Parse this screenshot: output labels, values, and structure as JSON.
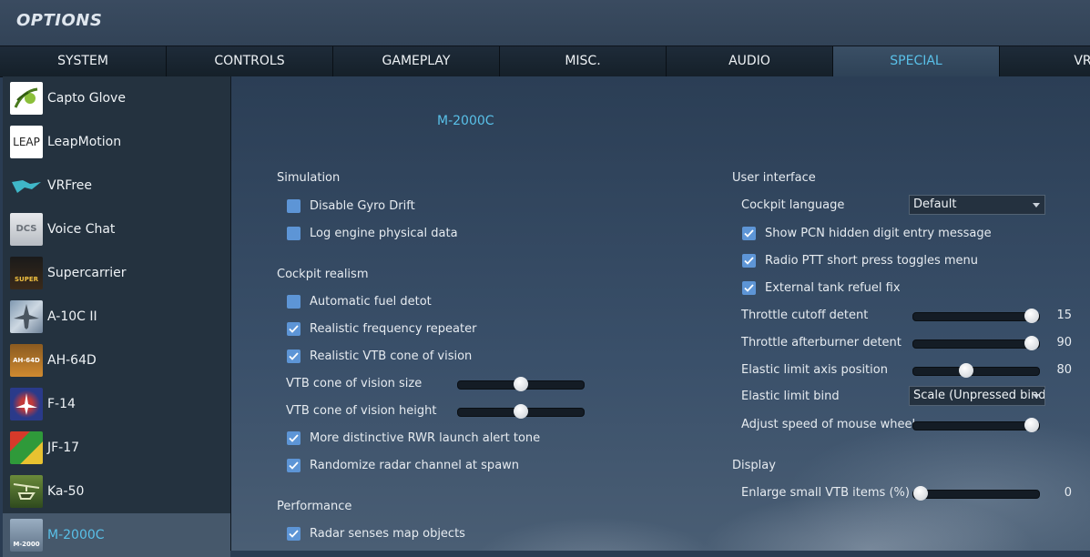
{
  "window": {
    "title": "OPTIONS"
  },
  "tabs": [
    "SYSTEM",
    "CONTROLS",
    "GAMEPLAY",
    "MISC.",
    "AUDIO",
    "SPECIAL",
    "VR"
  ],
  "active_tab": "SPECIAL",
  "sidebar": {
    "items": [
      {
        "label": "Capto Glove",
        "icon": "capto-glove-icon"
      },
      {
        "label": "LeapMotion",
        "icon": "leapmotion-icon",
        "icon_text": "LEAP"
      },
      {
        "label": "VRFree",
        "icon": "vrfree-icon"
      },
      {
        "label": "Voice Chat",
        "icon": "voice-chat-icon",
        "icon_text": "DCS"
      },
      {
        "label": "Supercarrier",
        "icon": "supercarrier-icon",
        "icon_text": "SUPER"
      },
      {
        "label": "A-10C II",
        "icon": "a10c-icon"
      },
      {
        "label": "AH-64D",
        "icon": "ah64d-icon",
        "icon_text": "AH-64D"
      },
      {
        "label": "F-14",
        "icon": "f14-icon"
      },
      {
        "label": "JF-17",
        "icon": "jf17-icon"
      },
      {
        "label": "Ka-50",
        "icon": "ka50-icon"
      },
      {
        "label": "M-2000C",
        "icon": "m2000c-icon",
        "icon_text": "M-2000"
      }
    ],
    "active": "M-2000C"
  },
  "main": {
    "module_title": "M-2000C",
    "left": {
      "simulation": {
        "title": "Simulation",
        "disable_gyro_drift": {
          "label": "Disable Gyro Drift",
          "checked": false
        },
        "log_engine": {
          "label": "Log engine physical data",
          "checked": false
        }
      },
      "cockpit_realism": {
        "title": "Cockpit realism",
        "auto_fuel_detot": {
          "label": "Automatic fuel detot",
          "checked": false
        },
        "freq_repeater": {
          "label": "Realistic frequency repeater",
          "checked": true
        },
        "vtb_cone": {
          "label": "Realistic VTB cone of vision",
          "checked": true
        },
        "vtb_cone_size": {
          "label": "VTB cone of vision size",
          "value_fraction": 0.5
        },
        "vtb_cone_height": {
          "label": "VTB cone of vision height",
          "value_fraction": 0.5
        },
        "rwr_tone": {
          "label": "More distinctive RWR launch alert tone",
          "checked": true
        },
        "radar_channel": {
          "label": "Randomize radar channel at spawn",
          "checked": true
        }
      },
      "performance": {
        "title": "Performance",
        "radar_map": {
          "label": "Radar senses map objects",
          "checked": true
        }
      }
    },
    "right": {
      "user_interface": {
        "title": "User interface",
        "cockpit_language": {
          "label": "Cockpit language",
          "value": "Default"
        },
        "pcn_message": {
          "label": "Show PCN hidden digit entry message",
          "checked": true
        },
        "radio_ptt": {
          "label": "Radio PTT short press toggles menu",
          "checked": true
        },
        "tank_refuel": {
          "label": "External tank refuel fix",
          "checked": true
        },
        "throttle_cutoff": {
          "label": "Throttle cutoff detent",
          "value": "15",
          "value_fraction": 1.0
        },
        "throttle_ab": {
          "label": "Throttle afterburner detent",
          "value": "90",
          "value_fraction": 1.0
        },
        "elastic_axis": {
          "label": "Elastic limit axis position",
          "value": "80",
          "value_fraction": 0.41
        },
        "elastic_bind": {
          "label": "Elastic limit bind",
          "value": "Scale (Unpressed bind"
        },
        "mouse_wheel": {
          "label": "Adjust speed of mouse wheel",
          "value_fraction": 1.0
        }
      },
      "display": {
        "title": "Display",
        "enlarge_vtb": {
          "label": "Enlarge small VTB items (%)",
          "value": "0",
          "value_fraction": 0.0
        }
      }
    }
  },
  "colors": {
    "accent": "#59c0e8",
    "checkbox": "#5d95d6",
    "sidebar_active": "#46586b"
  }
}
